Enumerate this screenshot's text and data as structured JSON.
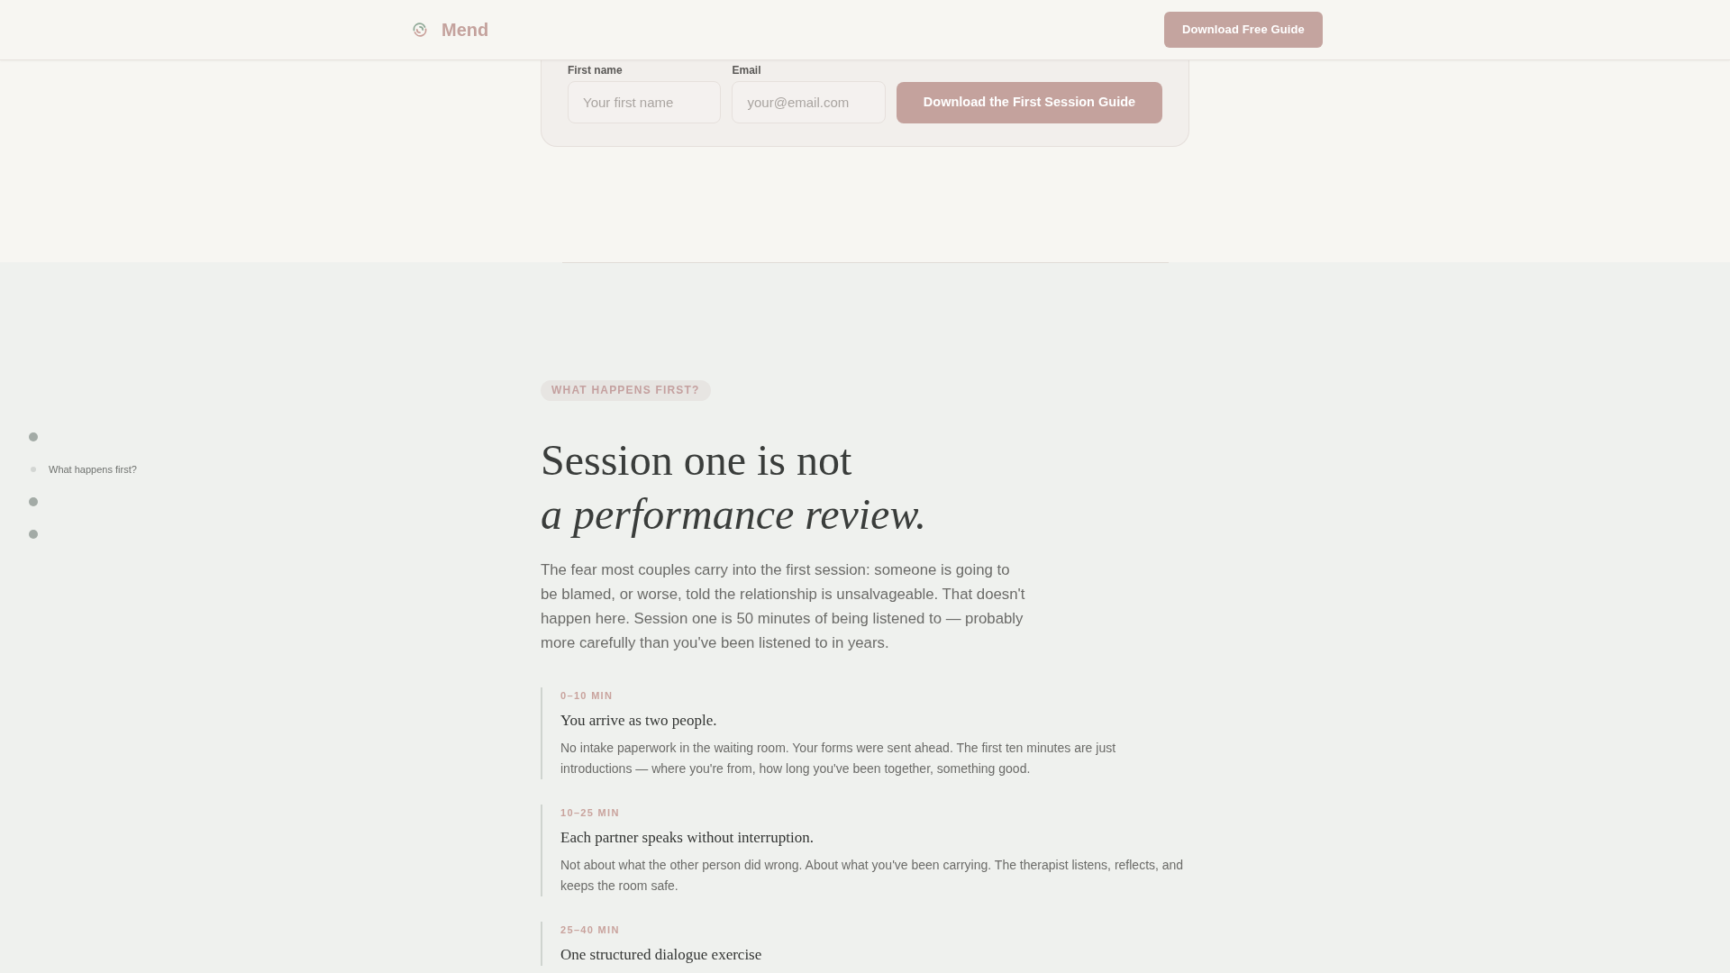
{
  "header": {
    "brand": "Mend",
    "cta": "Download Free Guide"
  },
  "signup_form": {
    "fields": [
      {
        "label": "First name",
        "placeholder": "Your first name"
      },
      {
        "label": "Email",
        "placeholder": "your@email.com"
      }
    ],
    "submit": "Download the First Session Guide"
  },
  "section_nav": [
    {
      "selected": false
    },
    {
      "selected": true,
      "label": "What happens first?"
    },
    {
      "selected": false
    },
    {
      "selected": false
    }
  ],
  "section": {
    "badge": "WHAT HAPPENS FIRST?",
    "heading": "Session one is not",
    "heading_italic": "a performance review.",
    "intro": "The fear most couples carry into the first session: someone is going to be blamed, or worse, told the relationship is unsalvageable. That doesn't happen here. Session one is 50 minutes of being listened to — probably more carefully than you've been listened to in years.",
    "timeline": [
      {
        "time": "0–10 MIN",
        "title": "You arrive as two people.",
        "text": "No intake paperwork in the waiting room. Your forms were sent ahead. The first ten minutes are just introductions — where you're from, how long you've been together, something good."
      },
      {
        "time": "10–25 MIN",
        "title": "Each partner speaks without interruption.",
        "text": "Not about what the other person did wrong. About what you've been carrying. The therapist listens, reflects, and keeps the room safe."
      },
      {
        "time": "25–40 MIN",
        "title": "One structured dialogue exercise"
      }
    ]
  }
}
